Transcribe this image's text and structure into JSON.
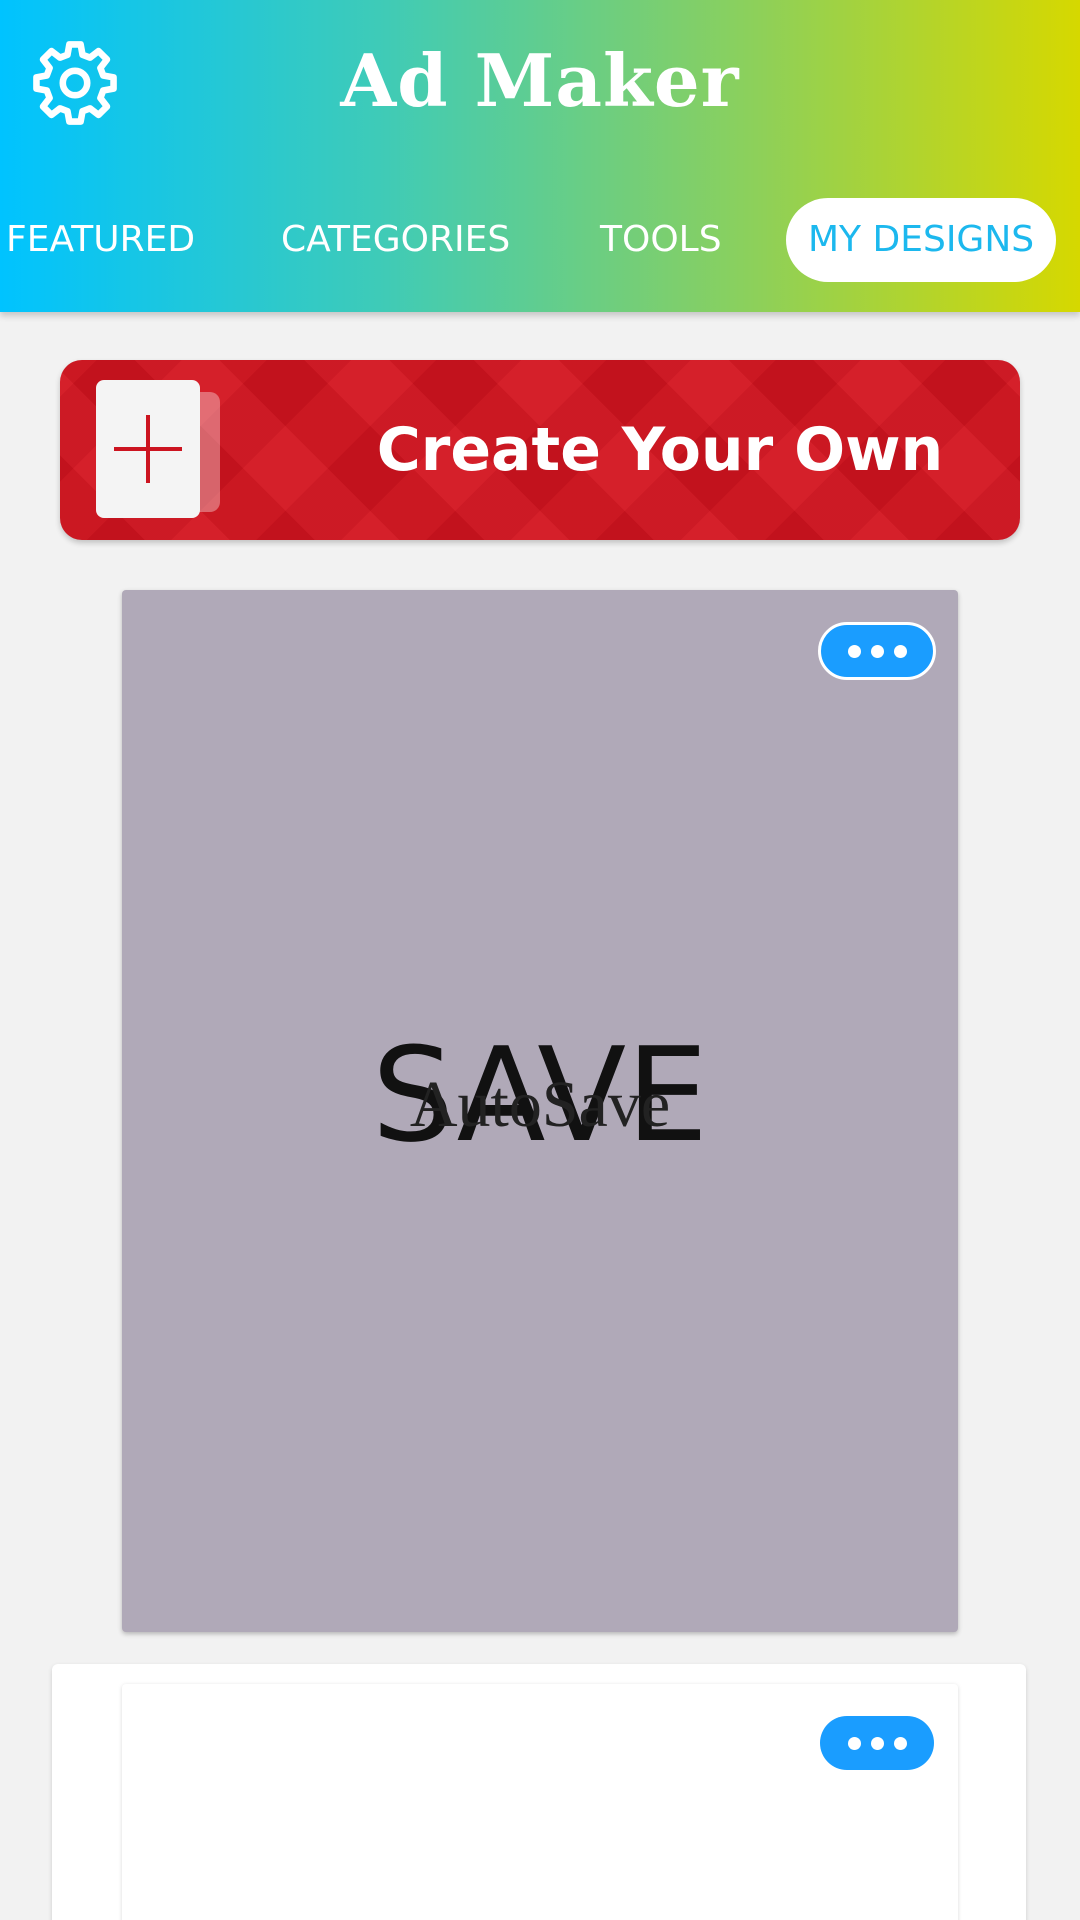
{
  "app": {
    "title": "Ad Maker",
    "settings_icon": "gear-icon"
  },
  "tabs": [
    {
      "label": "FEATURED",
      "active": false
    },
    {
      "label": "CATEGORIES",
      "active": false
    },
    {
      "label": "TOOLS",
      "active": false
    },
    {
      "label": "MY DESIGNS",
      "active": true
    }
  ],
  "create": {
    "label": "Create Your Own",
    "icon": "plus-icon"
  },
  "designs": [
    {
      "preview_text": "SAVE",
      "preview_subtext": "AutoSave",
      "more_icon": "more-dots-icon",
      "background": "#b0a9b8"
    },
    {
      "preview_text": "",
      "more_icon": "more-dots-icon",
      "background": "#ffffff"
    }
  ],
  "colors": {
    "accent": "#1a9dff",
    "create_red": "#d3141f",
    "active_tab_text": "#1cb8ee"
  }
}
